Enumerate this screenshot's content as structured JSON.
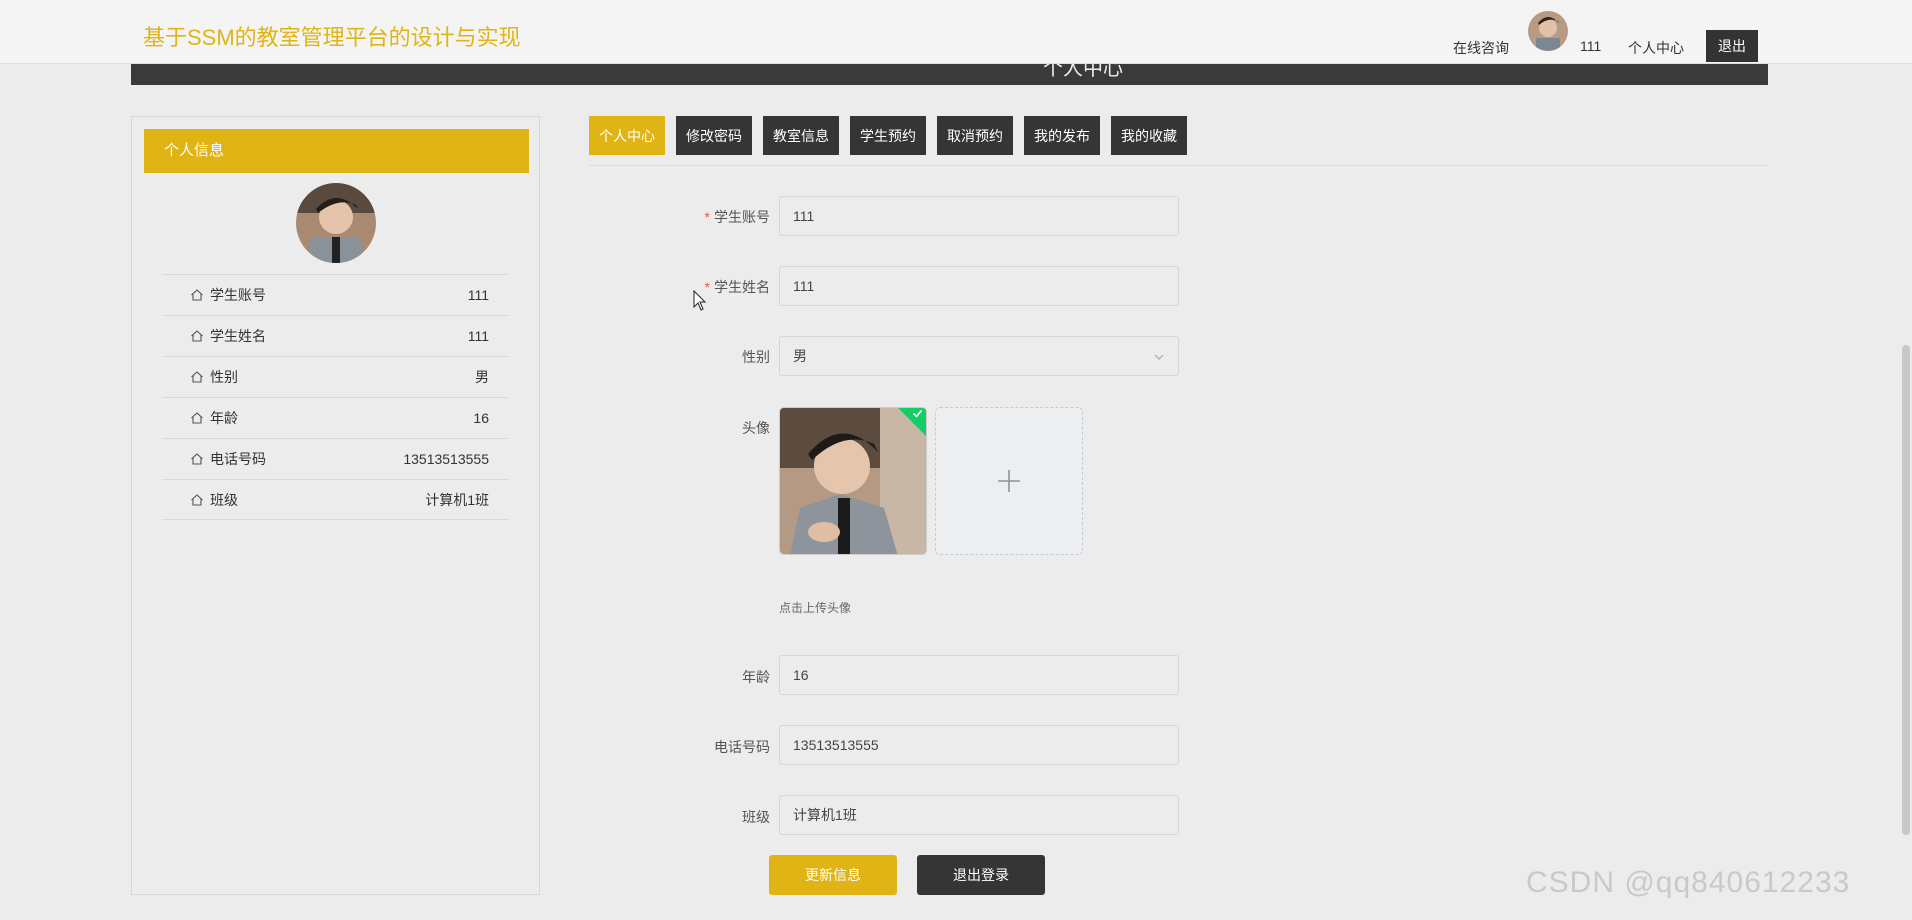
{
  "header": {
    "site_title": "基于SSM的教室管理平台的设计与实现",
    "online_consult": "在线咨询",
    "username": "111",
    "personal_center": "个人中心",
    "logout": "退出",
    "banner_text": "个人中心"
  },
  "left_panel": {
    "title": "个人信息",
    "rows": [
      {
        "label": "学生账号",
        "value": "111"
      },
      {
        "label": "学生姓名",
        "value": "111"
      },
      {
        "label": "性别",
        "value": "男"
      },
      {
        "label": "年龄",
        "value": "16"
      },
      {
        "label": "电话号码",
        "value": "13513513555"
      },
      {
        "label": "班级",
        "value": "计算机1班"
      }
    ]
  },
  "tabs": [
    {
      "label": "个人中心",
      "active": true
    },
    {
      "label": "修改密码"
    },
    {
      "label": "教室信息"
    },
    {
      "label": "学生预约"
    },
    {
      "label": "取消预约"
    },
    {
      "label": "我的发布"
    },
    {
      "label": "我的收藏"
    }
  ],
  "form": {
    "account_label": "学生账号",
    "account_value": "111",
    "name_label": "学生姓名",
    "name_value": "111",
    "gender_label": "性别",
    "gender_value": "男",
    "avatar_label": "头像",
    "upload_tip": "点击上传头像",
    "age_label": "年龄",
    "age_value": "16",
    "phone_label": "电话号码",
    "phone_value": "13513513555",
    "class_label": "班级",
    "class_value": "计算机1班",
    "required_mark": "*",
    "update_button": "更新信息",
    "logout_button": "退出登录"
  },
  "watermark": "CSDN @qq840612233",
  "colors": {
    "accent": "#e0b414",
    "dark": "#353535",
    "success": "#13ce66"
  }
}
